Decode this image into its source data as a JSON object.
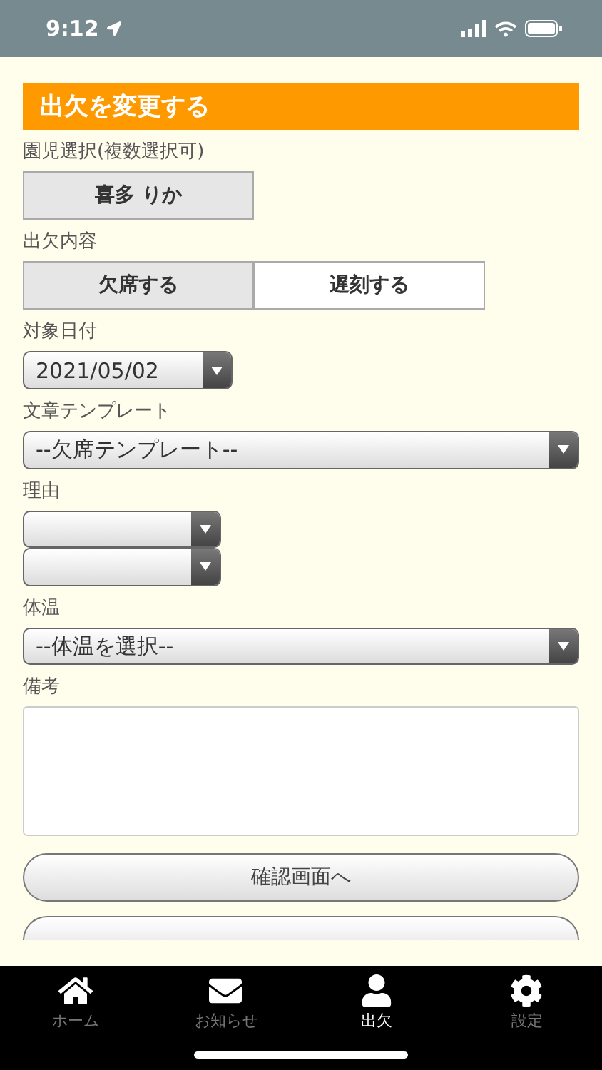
{
  "status_bar": {
    "time": "9:12"
  },
  "header": {
    "title": "出欠を変更する"
  },
  "child_select": {
    "label": "園児選択(複数選択可)",
    "options": [
      {
        "name": "喜多 りか",
        "selected": true
      }
    ]
  },
  "attendance_type": {
    "label": "出欠内容",
    "options": [
      {
        "label": "欠席する",
        "selected": true
      },
      {
        "label": "遅刻する",
        "selected": false
      }
    ]
  },
  "date": {
    "label": "対象日付",
    "value": "2021/05/02"
  },
  "template": {
    "label": "文章テンプレート",
    "value": "--欠席テンプレート--"
  },
  "reason": {
    "label": "理由",
    "selects": [
      {
        "kind": "dropdown"
      },
      {
        "kind": "dropdown"
      }
    ]
  },
  "temperature": {
    "label": "体温",
    "value": "--体温を選択--"
  },
  "notes": {
    "label": "備考"
  },
  "buttons": [
    {
      "label": "確認画面へ"
    }
  ],
  "tab_bar": [
    {
      "label": "ホーム",
      "kind": "home",
      "selected": false
    },
    {
      "label": "お知らせ",
      "kind": "mail",
      "selected": false
    },
    {
      "label": "出欠",
      "kind": "person",
      "selected": true
    },
    {
      "label": "設定",
      "kind": "gear",
      "selected": false
    }
  ]
}
